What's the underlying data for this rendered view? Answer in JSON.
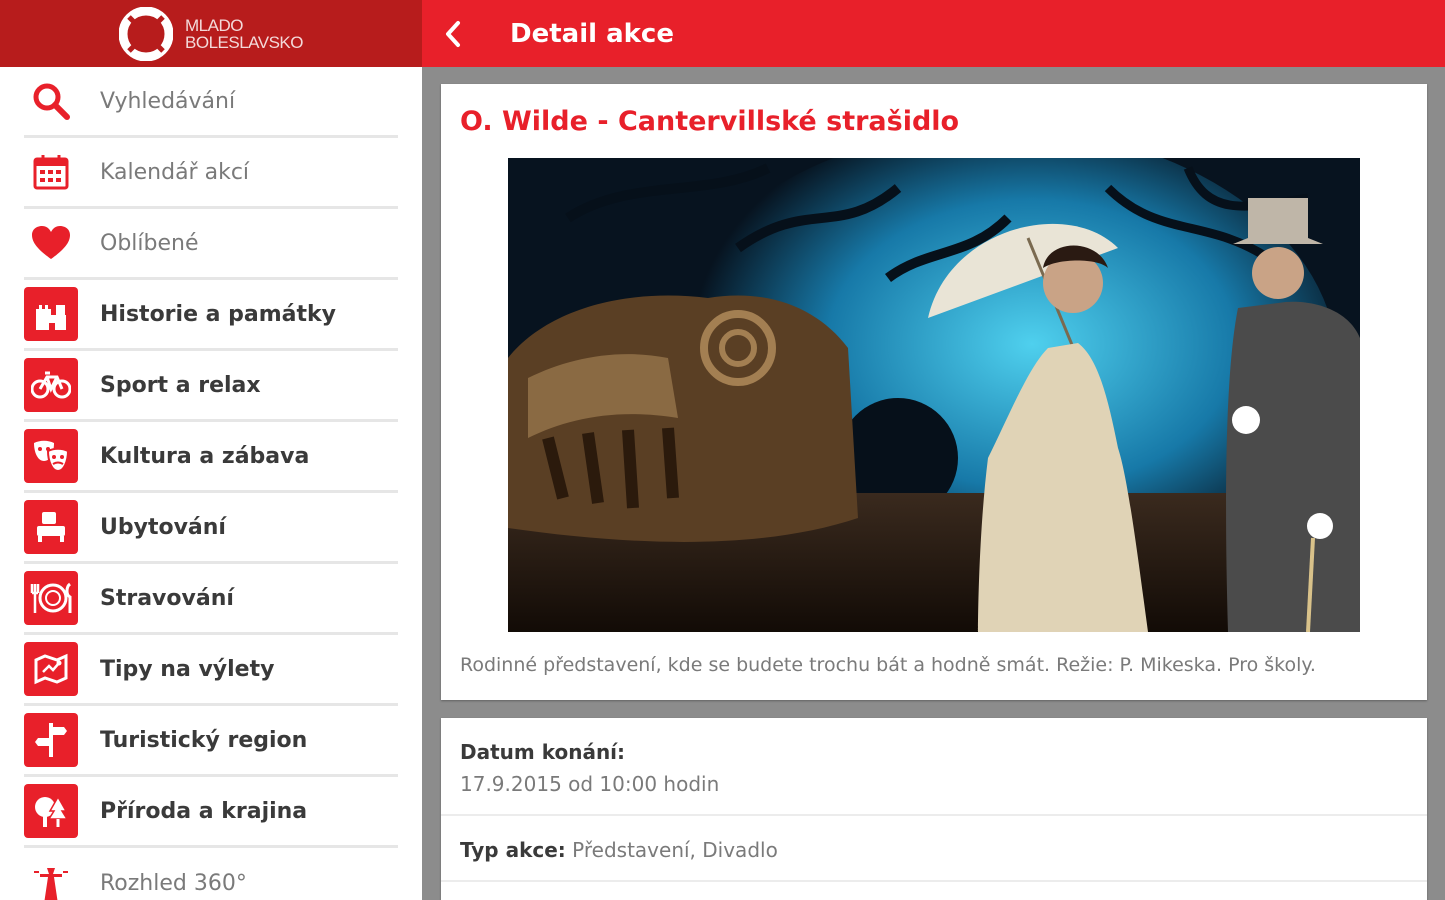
{
  "brand": {
    "logo_line1": "MLADO",
    "logo_line2": "BOLESLAVSKO",
    "accent_color": "#e8202a",
    "header_dark_color": "#b71c1c"
  },
  "sidebar": {
    "items": [
      {
        "label": "Vyhledávání",
        "icon": "search-icon",
        "bold": false
      },
      {
        "label": "Kalendář akcí",
        "icon": "calendar-icon",
        "bold": false
      },
      {
        "label": "Oblíbené",
        "icon": "heart-icon",
        "bold": false
      },
      {
        "label": "Historie a památky",
        "icon": "castle-icon",
        "bold": true
      },
      {
        "label": "Sport a relax",
        "icon": "bicycle-icon",
        "bold": true
      },
      {
        "label": "Kultura a zábava",
        "icon": "theater-masks-icon",
        "bold": true
      },
      {
        "label": "Ubytování",
        "icon": "bed-icon",
        "bold": true
      },
      {
        "label": "Stravování",
        "icon": "plate-cutlery-icon",
        "bold": true
      },
      {
        "label": "Tipy na výlety",
        "icon": "map-icon",
        "bold": true
      },
      {
        "label": "Turistický region",
        "icon": "signpost-icon",
        "bold": true
      },
      {
        "label": "Příroda a krajina",
        "icon": "trees-icon",
        "bold": true
      },
      {
        "label": "Rozhled 360°",
        "icon": "lookout-tower-icon",
        "bold": false
      }
    ]
  },
  "topbar": {
    "title": "Detail akce",
    "back_icon": "chevron-left-icon"
  },
  "event": {
    "title": "O. Wilde - Cantervillské strašidlo",
    "image_alt": "theater-stage-photo",
    "description": "Rodinné představení, kde se budete trochu bát a hodně smát. Režie: P. Mikeska. Pro školy."
  },
  "details": {
    "date_label": "Datum konání:",
    "date_value": "17.9.2015 od 10:00 hodin",
    "type_label": "Typ akce:",
    "type_value": " Představení, Divadlo"
  }
}
